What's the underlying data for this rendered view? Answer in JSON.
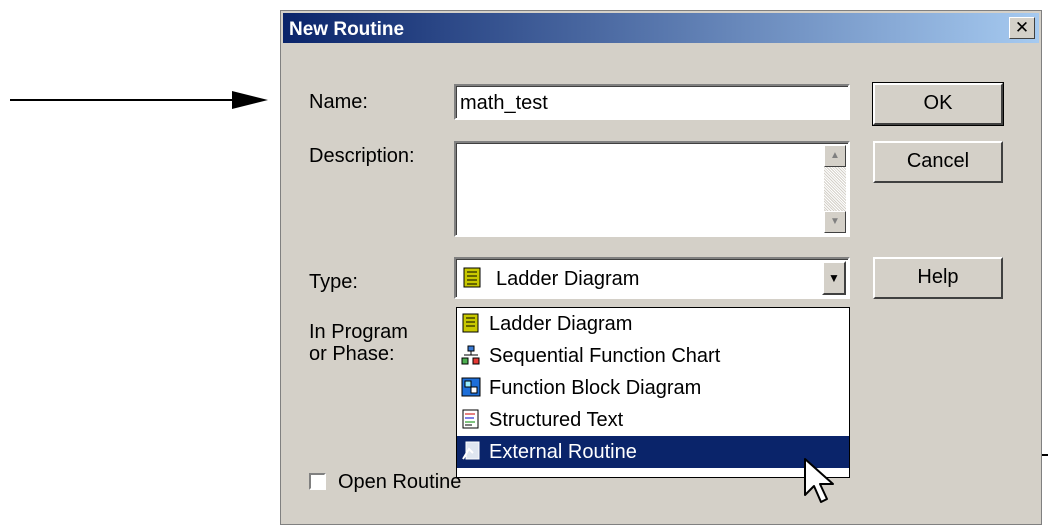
{
  "dialog": {
    "title": "New Routine",
    "close_label": "✕"
  },
  "form": {
    "name_label": "Name:",
    "name_value": "math_test",
    "description_label": "Description:",
    "description_value": "",
    "type_label": "Type:",
    "type_value": "Ladder Diagram",
    "program_label_line1": "In Program",
    "program_label_line2": "or Phase:",
    "open_routine_label": "Open Routine",
    "open_routine_checked": false
  },
  "buttons": {
    "ok": "OK",
    "cancel": "Cancel",
    "help": "Help"
  },
  "type_options": [
    {
      "label": "Ladder Diagram",
      "icon": "ladder-diagram-icon"
    },
    {
      "label": "Sequential Function Chart",
      "icon": "sfc-icon"
    },
    {
      "label": "Function Block Diagram",
      "icon": "fbd-icon"
    },
    {
      "label": "Structured Text",
      "icon": "structured-text-icon"
    },
    {
      "label": "External Routine",
      "icon": "external-routine-icon",
      "selected": true
    }
  ],
  "colors": {
    "titlebar_start": "#0a246a",
    "titlebar_end": "#a6caf0",
    "dialog_face": "#d4d0c8",
    "selection": "#0a246a"
  }
}
